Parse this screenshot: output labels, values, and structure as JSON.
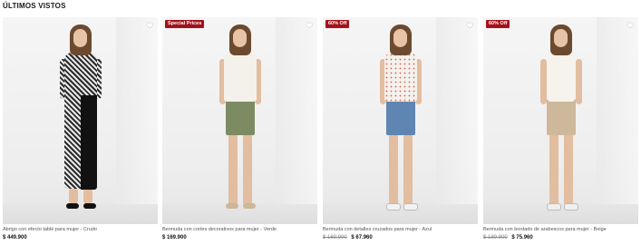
{
  "section": {
    "title": "ÚLTIMOS VISTOS"
  },
  "products": [
    {
      "badge": "",
      "name": "Abrigo con efecto tablé para mujer - Crudo",
      "old_price": "",
      "price": "$ 449.900",
      "colors": {
        "top": "#2b2b2b",
        "bottom": "#111111"
      }
    },
    {
      "badge": "Special Prices",
      "name": "Bermuda con cortes decorativos para mujer - Verde",
      "old_price": "",
      "price": "$ 169.900",
      "colors": {
        "top": "#f3f1ea",
        "bottom": "#7d8b63"
      }
    },
    {
      "badge": "60% Off",
      "name": "Bermuda con detalles cruzados para mujer - Azul",
      "old_price": "$ 169.900",
      "price": "$ 67.960",
      "colors": {
        "top": "#f4f1ec",
        "bottom": "#5f86b2"
      }
    },
    {
      "badge": "60% Off",
      "name": "Bermuda con bordado de arabescos para mujer - Beige",
      "old_price": "$ 189.900",
      "price": "$ 75.960",
      "colors": {
        "top": "#f6f3ec",
        "bottom": "#cdb89b"
      }
    }
  ],
  "icons": {
    "favorite": "heart-icon"
  },
  "theme": {
    "badge_bg": "#a3121b"
  }
}
